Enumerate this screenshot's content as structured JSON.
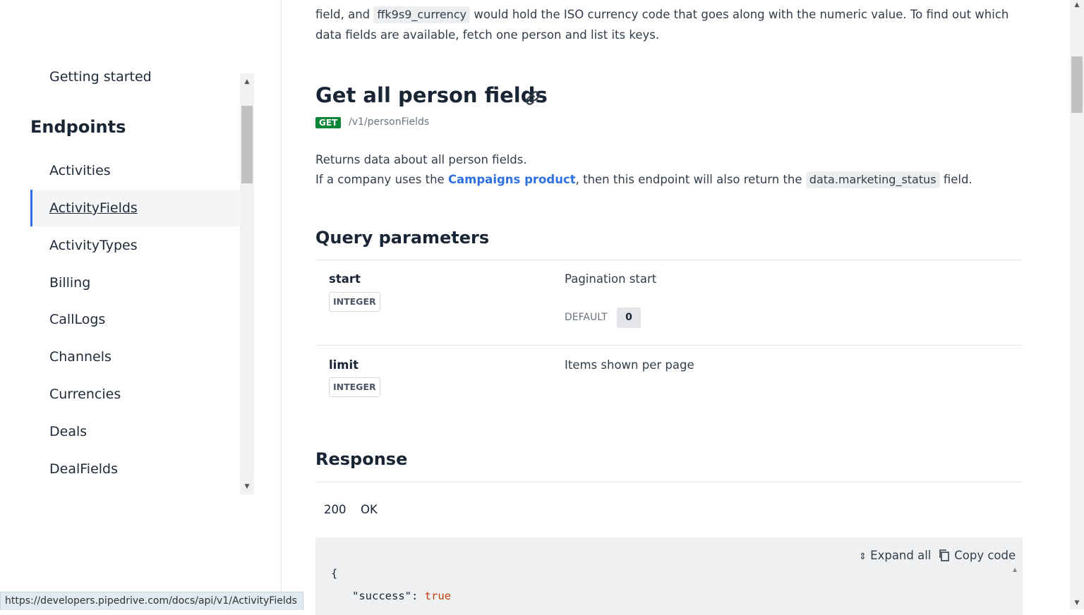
{
  "sidebar": {
    "top_item": "Getting started",
    "section_heading": "Endpoints",
    "items": [
      {
        "label": "Activities",
        "active": false
      },
      {
        "label": "ActivityFields",
        "active": true
      },
      {
        "label": "ActivityTypes",
        "active": false
      },
      {
        "label": "Billing",
        "active": false
      },
      {
        "label": "CallLogs",
        "active": false
      },
      {
        "label": "Channels",
        "active": false
      },
      {
        "label": "Currencies",
        "active": false
      },
      {
        "label": "Deals",
        "active": false
      },
      {
        "label": "DealFields",
        "active": false
      }
    ]
  },
  "status_bar": {
    "url": "https://developers.pipedrive.com/docs/api/v1/ActivityFields"
  },
  "intro": {
    "part1": "field, and ",
    "code": "ffk9s9_currency",
    "part2": " would hold the ISO currency code that goes along with the numeric value. To find out which data fields are available, fetch one person and list its keys."
  },
  "endpoint": {
    "title": "Get all person fields",
    "method": "GET",
    "path": "/v1/personFields",
    "description_line1": "Returns data about all person fields.",
    "description_line2_pre": "If a company uses the ",
    "description_link": "Campaigns product",
    "description_line2_mid": ", then this endpoint will also return the ",
    "description_code": "data.marketing_status",
    "description_line2_post": " field."
  },
  "query_parameters": {
    "heading": "Query parameters",
    "params": [
      {
        "name": "start",
        "type": "INTEGER",
        "description": "Pagination start",
        "default_label": "DEFAULT",
        "default_value": "0"
      },
      {
        "name": "limit",
        "type": "INTEGER",
        "description": "Items shown per page"
      }
    ]
  },
  "response": {
    "heading": "Response",
    "status_code": "200",
    "status_text": "OK",
    "expand_all": "Expand all",
    "copy_code": "Copy code",
    "code_open_brace": "{",
    "code_key": "\"success\":",
    "code_value": "true"
  },
  "colors": {
    "accent": "#2f6fdf",
    "get_badge": "#098538",
    "code_bool": "#c2410c"
  }
}
